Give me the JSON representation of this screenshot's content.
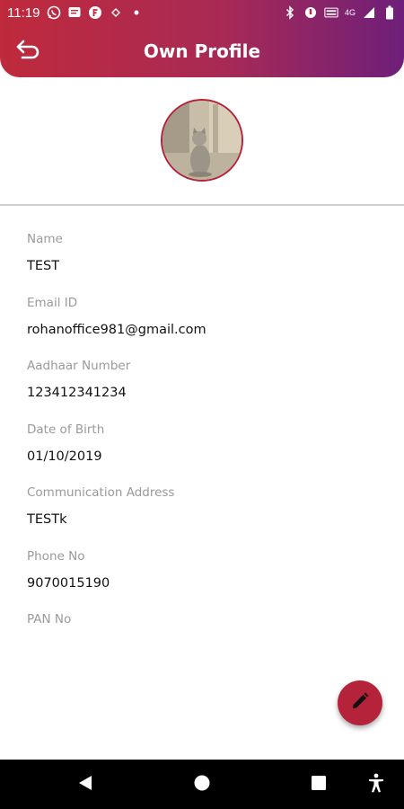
{
  "status_bar": {
    "time": "11:19",
    "network": "4G"
  },
  "header": {
    "title": "Own Profile"
  },
  "profile": {
    "fields": [
      {
        "label": "Name",
        "value": "TEST"
      },
      {
        "label": "Email ID",
        "value": "rohanoffice981@gmail.com"
      },
      {
        "label": "Aadhaar Number",
        "value": "123412341234"
      },
      {
        "label": "Date of Birth",
        "value": "01/10/2019"
      },
      {
        "label": "Communication Address",
        "value": "TESTk"
      },
      {
        "label": "Phone No",
        "value": "9070015190"
      },
      {
        "label": "PAN No",
        "value": ""
      }
    ]
  },
  "colors": {
    "gradient_start": "#bf2a3c",
    "gradient_end": "#6e1f7a",
    "accent": "#b4233a",
    "label": "#9a9a9a"
  },
  "icons": {
    "back": "back-arrow-icon",
    "edit": "pencil-icon",
    "nav_back": "triangle-back-icon",
    "nav_home": "circle-home-icon",
    "nav_recents": "square-recents-icon",
    "nav_accessibility": "accessibility-icon"
  }
}
